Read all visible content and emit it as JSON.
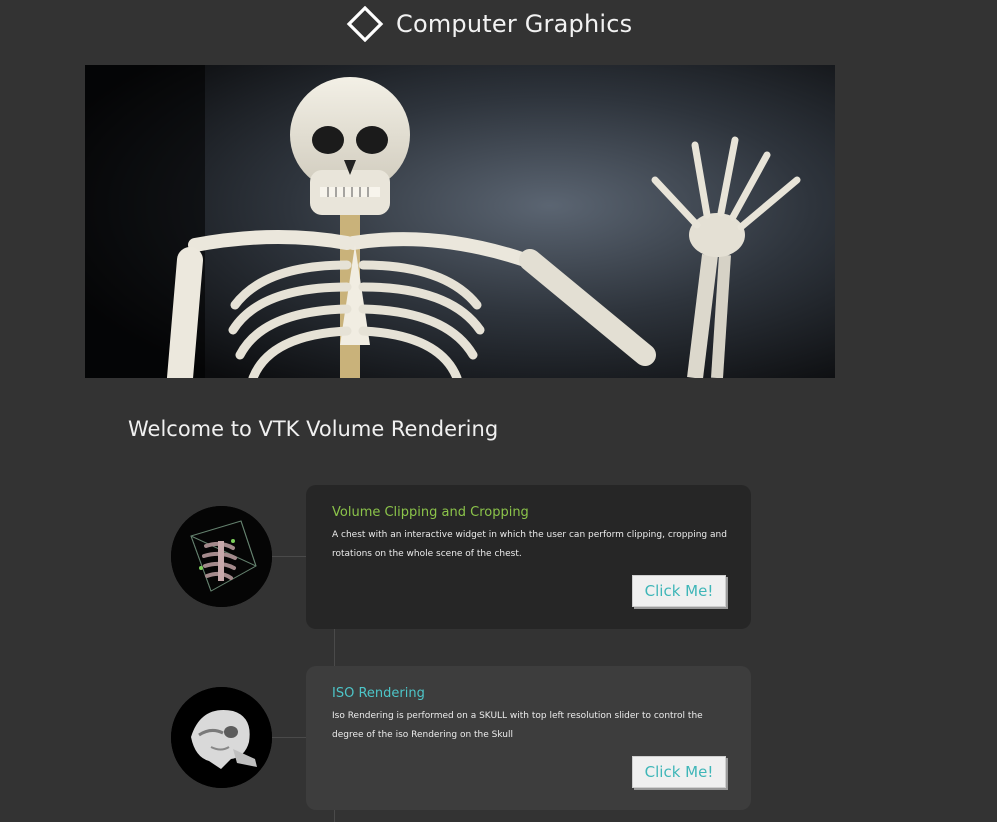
{
  "header": {
    "title": "Computer Graphics",
    "logo_icon": "diamond-logo-icon"
  },
  "hero": {
    "image": "skeleton-waving-hero-image"
  },
  "welcome": {
    "heading": "Welcome to VTK Volume Rendering"
  },
  "items": [
    {
      "title": "Volume Clipping and Cropping",
      "description": "A chest with an interactive widget in which the user can perform clipping, cropping and rotations on the whole scene of the chest.",
      "button_label": "Click Me!",
      "thumbnail": "chest-volume-thumbnail",
      "title_color": "#8bc34a"
    },
    {
      "title": "ISO Rendering",
      "description": "Iso Rendering is performed on a SKULL with top left resolution slider to control the degree of the iso Rendering on the Skull",
      "button_label": "Click Me!",
      "thumbnail": "skull-iso-thumbnail",
      "title_color": "#4dc5c8"
    }
  ],
  "colors": {
    "background": "#333333",
    "card_dark": "#262626",
    "card_light": "#3d3d3d",
    "button_text": "#3fb6b8"
  }
}
